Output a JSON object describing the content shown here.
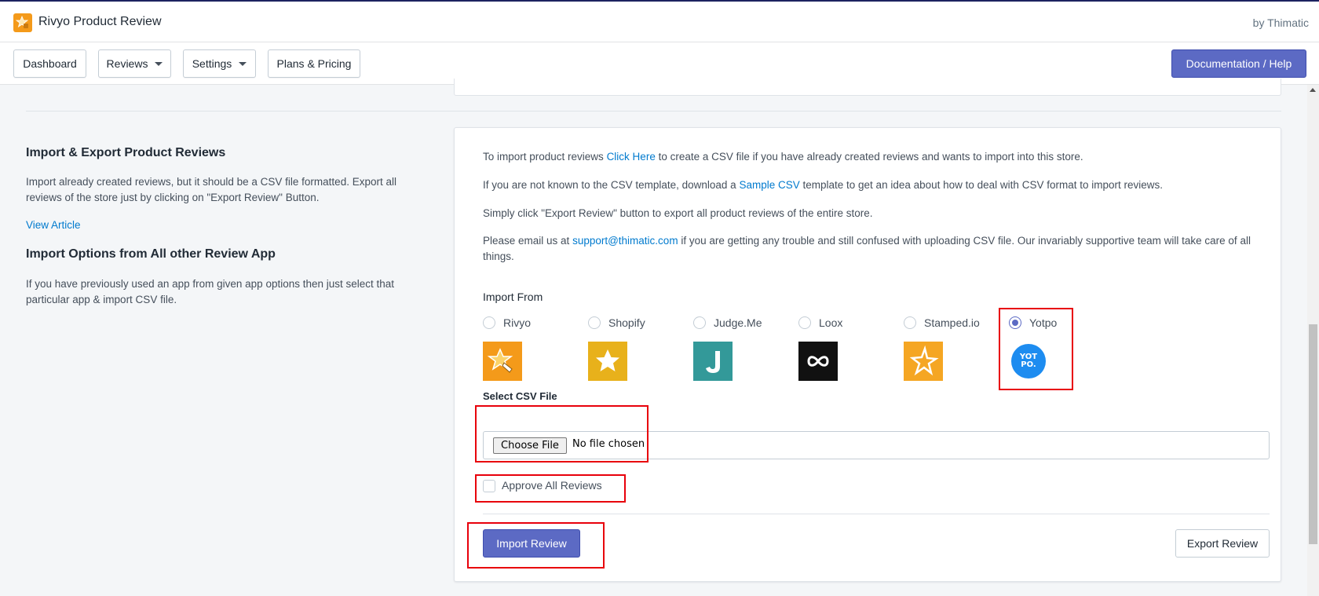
{
  "header": {
    "app_title": "Rivyo Product Review",
    "by": "by Thimatic",
    "logo_icon": "rivyo-logo-icon"
  },
  "nav": {
    "dashboard": "Dashboard",
    "reviews": "Reviews",
    "settings": "Settings",
    "plans": "Plans & Pricing",
    "documentation": "Documentation / Help"
  },
  "sidebar": {
    "heading1": "Import & Export Product Reviews",
    "desc1": "Import already created reviews, but it should be a CSV file formatted. Export all reviews of the store just by clicking on \"Export Review\" Button.",
    "link": "View Article",
    "heading2": "Import Options from All other Review App",
    "desc2": "If you have previously used an app from given app options then just select that particular app & import CSV file."
  },
  "card": {
    "p1_before": "To import product reviews ",
    "p1_link": "Click Here",
    "p1_after": " to create a CSV file if you have already created reviews and wants to import into this store.",
    "p2_before": "If you are not known to the CSV template, download a ",
    "p2_link": "Sample CSV",
    "p2_after": " template to get an idea about how to deal with CSV format to import reviews.",
    "p3": "Simply click \"Export Review\" button to export all product reviews of the entire store.",
    "p4_before": "Please email us at ",
    "p4_link": "support@thimatic.com",
    "p4_after": " if you are getting any trouble and still confused with uploading CSV file. Our invariably supportive team will take care of all things.",
    "import_from": "Import From",
    "options": [
      {
        "label": "Rivyo",
        "icon": "rivyo-icon",
        "selected": false,
        "color": "#f49a1a"
      },
      {
        "label": "Shopify",
        "icon": "star-icon",
        "selected": false,
        "color": "#e8b11b"
      },
      {
        "label": "Judge.Me",
        "icon": "judgeme-icon",
        "selected": false,
        "color": "#339999"
      },
      {
        "label": "Loox",
        "icon": "infinity-icon",
        "selected": false,
        "color": "#111111"
      },
      {
        "label": "Stamped.io",
        "icon": "stamped-star-icon",
        "selected": false,
        "color": "#f5a623"
      },
      {
        "label": "Yotpo",
        "icon": "yotpo-icon",
        "selected": true,
        "color": "#1d8cf0"
      }
    ],
    "yotpo_logo_text": "YOT PO.",
    "select_csv": "Select CSV File",
    "choose_file": "Choose File",
    "no_file": "No file chosen",
    "approve_all": "Approve All Reviews",
    "import_button": "Import Review",
    "export_button": "Export Review"
  },
  "colors": {
    "primary": "#5c6ac4",
    "link": "#007ace",
    "highlight": "#e8000b"
  }
}
